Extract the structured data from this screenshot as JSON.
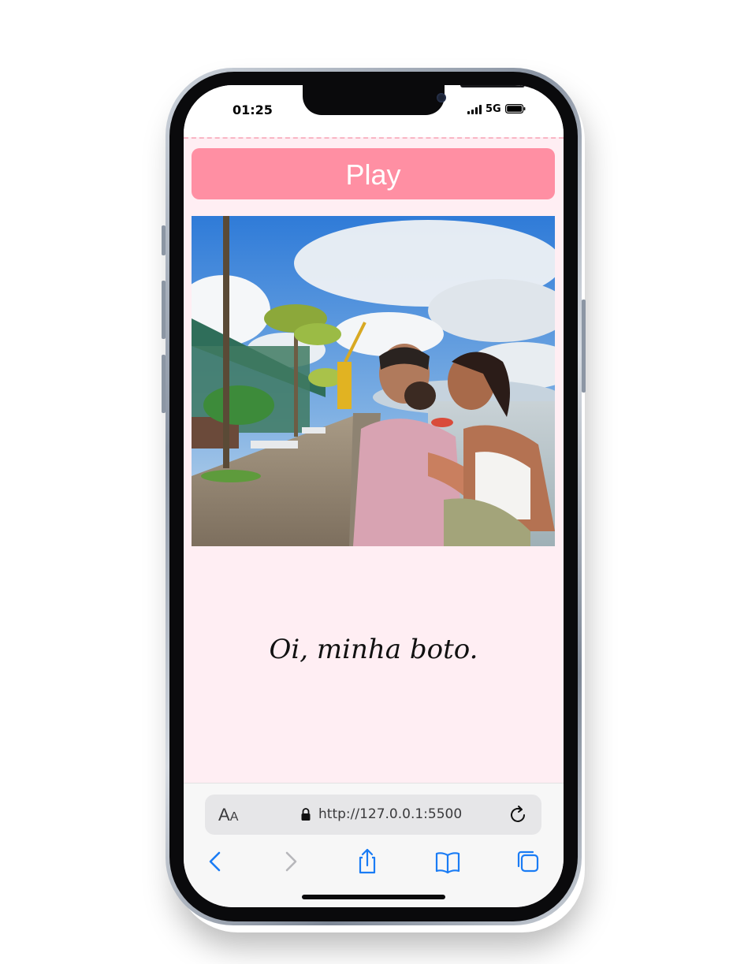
{
  "status_bar": {
    "time": "01:25",
    "network": "5G"
  },
  "page": {
    "play_label": "Play",
    "photo_alt": "Casal abraçado no cais",
    "greeting": "Oi, minha boto."
  },
  "browser": {
    "aa_label_big": "A",
    "aa_label_small": "A",
    "url": "http://127.0.0.1:5500"
  },
  "icons": {
    "back": "chevron-left-icon",
    "forward": "chevron-right-icon",
    "share": "share-icon",
    "bookmarks": "book-icon",
    "tabs": "tabs-icon",
    "reload": "reload-icon",
    "lock": "lock-icon"
  },
  "colors": {
    "play_button": "#ff8fa3",
    "page_background": "#ffeef3",
    "link_blue": "#1a7cf5"
  }
}
